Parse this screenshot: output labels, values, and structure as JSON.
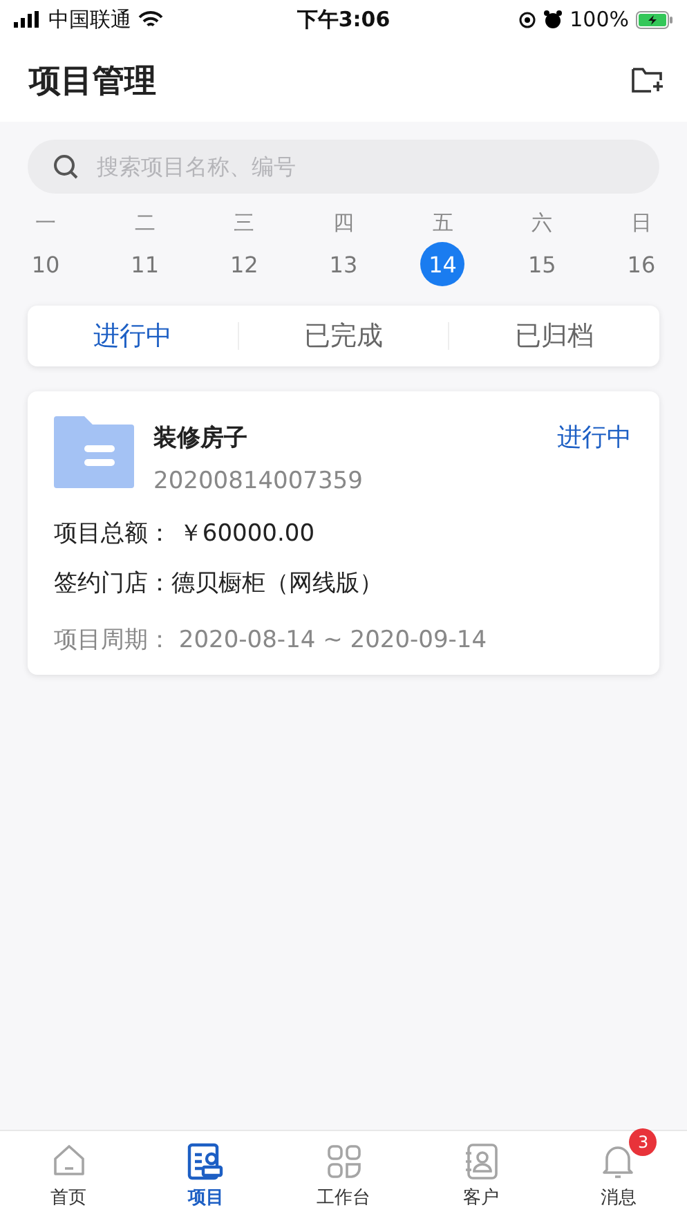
{
  "status_bar": {
    "carrier": "中国联通",
    "time": "下午3:06",
    "battery": "100%"
  },
  "header": {
    "title": "项目管理"
  },
  "search": {
    "placeholder": "搜索项目名称、编号"
  },
  "week": [
    {
      "weekday": "一",
      "date": "10",
      "selected": false
    },
    {
      "weekday": "二",
      "date": "11",
      "selected": false
    },
    {
      "weekday": "三",
      "date": "12",
      "selected": false
    },
    {
      "weekday": "四",
      "date": "13",
      "selected": false
    },
    {
      "weekday": "五",
      "date": "14",
      "selected": true
    },
    {
      "weekday": "六",
      "date": "15",
      "selected": false
    },
    {
      "weekday": "日",
      "date": "16",
      "selected": false
    }
  ],
  "tabs": [
    {
      "label": "进行中",
      "selected": true
    },
    {
      "label": "已完成",
      "selected": false
    },
    {
      "label": "已归档",
      "selected": false
    }
  ],
  "projects": [
    {
      "name": "装修房子",
      "number": "20200814007359",
      "status": "进行中",
      "amount_label": "项目总额：",
      "amount": "￥60000.00",
      "store_label": "签约门店：",
      "store": "德贝橱柜（网线版）",
      "period_label": "项目周期：",
      "period": "2020-08-14 ~ 2020-09-14"
    }
  ],
  "nav": [
    {
      "label": "首页",
      "selected": false
    },
    {
      "label": "项目",
      "selected": true
    },
    {
      "label": "工作台",
      "selected": false
    },
    {
      "label": "客户",
      "selected": false
    },
    {
      "label": "消息",
      "selected": false,
      "badge": "3"
    }
  ]
}
